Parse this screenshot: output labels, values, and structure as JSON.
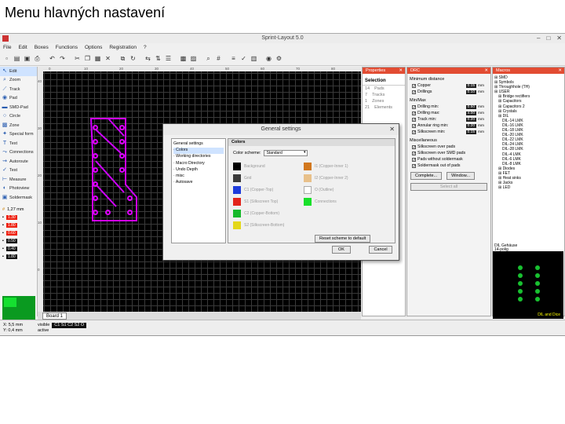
{
  "slide": {
    "title": "Menu hlavných nastavení"
  },
  "window": {
    "title": "Sprint-Layout 5.0",
    "controls": [
      "–",
      "□",
      "✕"
    ]
  },
  "menu": [
    "File",
    "Edit",
    "Boxes",
    "Functions",
    "Options",
    "Registration",
    "?"
  ],
  "toolbar_icons": [
    "new-icon",
    "open-icon",
    "save-icon",
    "print-icon",
    "sep",
    "undo-icon",
    "redo-icon",
    "sep",
    "cut-icon",
    "copy-icon",
    "paste-icon",
    "delete-icon",
    "sep",
    "duplicate-icon",
    "rotate-icon",
    "sep",
    "mirror-h-icon",
    "mirror-v-icon",
    "align-icon",
    "sep",
    "group-icon",
    "ungroup-icon",
    "sep",
    "zoom-icon",
    "grid-icon",
    "sep",
    "layers-icon",
    "drc-icon",
    "component-icon",
    "sep",
    "photo-icon",
    "settings-icon"
  ],
  "tools": [
    {
      "label": "Edit",
      "icon": "pointer-icon",
      "active": true
    },
    {
      "label": "Zoom",
      "icon": "zoom-icon"
    },
    {
      "label": "Track",
      "icon": "track-icon"
    },
    {
      "label": "Pad",
      "icon": "pad-icon"
    },
    {
      "label": "SMD-Pad",
      "icon": "smd-pad-icon"
    },
    {
      "label": "Circle",
      "icon": "circle-icon"
    },
    {
      "label": "Zone",
      "icon": "zone-icon"
    },
    {
      "label": "Special form",
      "icon": "special-form-icon"
    },
    {
      "label": "Text",
      "icon": "text-icon"
    },
    {
      "label": "Connections",
      "icon": "connections-icon"
    },
    {
      "label": "Autoroute",
      "icon": "autoroute-icon"
    },
    {
      "label": "Test",
      "icon": "test-icon"
    },
    {
      "label": "Measure",
      "icon": "measure-icon"
    },
    {
      "label": "Photoview",
      "icon": "photoview-icon"
    },
    {
      "label": "Soldermask",
      "icon": "soldermask-icon"
    }
  ],
  "params": {
    "grid": "1,27 mm",
    "values": [
      "1.30",
      "1.80",
      "0.60",
      "0.50",
      "0.40",
      "1.80"
    ]
  },
  "rulers": {
    "h": [
      "0",
      "10",
      "20",
      "30",
      "40",
      "50",
      "60",
      "70",
      "80",
      "90"
    ],
    "v": [
      "40",
      "30",
      "20",
      "10",
      "0"
    ]
  },
  "board_tab": "Board 1",
  "status": {
    "x": "X: 5,5 mm",
    "y": "Y: 0,4 mm",
    "visible": "visible",
    "active": "active",
    "layers": "C1 S1 C2 S2 O"
  },
  "properties": {
    "title": "Properties",
    "selection": "Selection",
    "rows": [
      [
        "14",
        "Pads"
      ],
      [
        "7",
        "Tracks"
      ],
      [
        "1",
        "Zones"
      ],
      [
        "21",
        "Elements"
      ]
    ]
  },
  "drc": {
    "title": "DRC",
    "min_distance": "Minimum distance",
    "md_items": [
      {
        "label": "Copper",
        "value": "0.15",
        "unit": "mm"
      },
      {
        "label": "Drillings",
        "value": "0.10",
        "unit": "mm"
      }
    ],
    "minmax": "Min/Max",
    "mm_items": [
      {
        "label": "Drilling min:",
        "value": "0.50",
        "unit": "mm"
      },
      {
        "label": "Drilling max:",
        "value": "4.00",
        "unit": "mm"
      },
      {
        "label": "Track min:",
        "value": "0.20",
        "unit": "mm"
      },
      {
        "label": "Annular ring min:",
        "value": "0.20",
        "unit": "mm"
      },
      {
        "label": "Silkscreen min:",
        "value": "0.15",
        "unit": "mm"
      }
    ],
    "misc": "Miscellaneous",
    "misc_items": [
      "Silkscreen over pads",
      "Silkscreen over SMD pads",
      "Pads without soldermask",
      "Soldermask out of pads"
    ],
    "complete": "Complete...",
    "window": "Window...",
    "select_all": "Select all"
  },
  "macros": {
    "title": "Macros",
    "tree": [
      "SMD",
      "Symbols",
      "Throughhole (TH)",
      "USER",
      "Bridge rectifiers",
      "Capacitors",
      "Capacitors 2",
      "Crystals",
      "DIL",
      "DIL-14 LMK",
      "DIL-16 LMK",
      "DIL-18 LMK",
      "DIL-20 LMK",
      "DIL-22 LMK",
      "DIL-24 LMK",
      "DIL-28 LMK",
      "DIL-4 LMK",
      "DIL-6 LMK",
      "DIL-8 LMK",
      "Diodes",
      "FET",
      "Heat sinks",
      "Jacks",
      "LED"
    ],
    "preview_label": "DIL Gehäuse",
    "preview_sub": "14-polig",
    "preview_footer": "DIL and Dice"
  },
  "dialog": {
    "title": "General settings",
    "nav": [
      "General settings",
      "Colors",
      "Working directories",
      "Macro Directory",
      "Undo Depth",
      "misc",
      "Autosave"
    ],
    "pane_title": "Colors",
    "scheme_label": "Color scheme:",
    "scheme_value": "Standard",
    "color_rows": [
      {
        "label": "Background",
        "color": "#000000"
      },
      {
        "label": "Grid",
        "color": "#3a3a3a"
      },
      {
        "label": "C1 (Copper-Top)",
        "color": "#1d3bdb"
      },
      {
        "label": "S1 (Silkscreen Top)",
        "color": "#e2231a"
      },
      {
        "label": "C2 (Copper-Bottom)",
        "color": "#16b92a"
      },
      {
        "label": "S2 (Silkscreen-Bottom)",
        "color": "#e4d81a"
      }
    ],
    "color_rows_right": [
      {
        "label": "I1 (Copper-Inner 1)",
        "color": "#d2781e"
      },
      {
        "label": "I2 (Copper-Inner 2)",
        "color": "#e8c08a"
      },
      {
        "label": "O (Outline)",
        "color": "#ffffff"
      },
      {
        "label": "Connections",
        "color": "#19e02a"
      }
    ],
    "reset": "Reset scheme to default",
    "ok": "OK",
    "cancel": "Cancel"
  },
  "colors": {
    "accent": "#e24c32",
    "silk": "#d000ff",
    "panel_head": "#e24c32"
  }
}
